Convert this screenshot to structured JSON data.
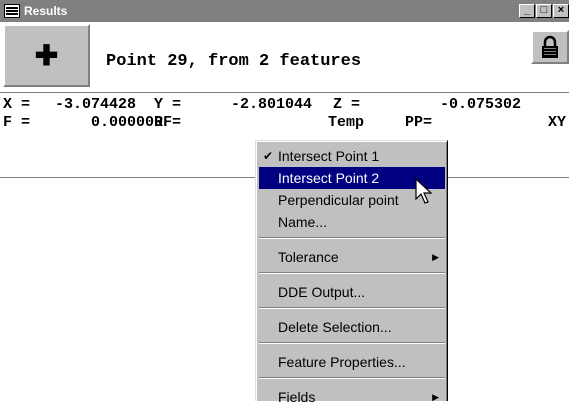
{
  "window": {
    "title": "Results",
    "title_icon": "table-grid-icon",
    "controls": [
      "minimize-icon",
      "maximize-icon",
      "close-icon"
    ]
  },
  "point_button": {
    "icon": "crosshair-plus-icon",
    "glyph": "✚"
  },
  "point_title": "Point 29, from 2 features",
  "lock_button": {
    "icon": "padlock-icon"
  },
  "readout": {
    "row1": {
      "x_label": "X =",
      "x_value": "-3.074428",
      "y_label": "Y =",
      "y_value": "-2.801044",
      "z_label": "Z =",
      "z_value": "-0.075302"
    },
    "row2": {
      "f_label": "F =",
      "f_value": "0.000000",
      "rf_label": "RF=",
      "rf_value": "Temp",
      "pp_label": "PP=",
      "pp_value": "XY"
    }
  },
  "menu": {
    "items": [
      {
        "label": "Intersect Point 1",
        "checked": true
      },
      {
        "label": "Intersect Point 2",
        "selected": true
      },
      {
        "label": "Perpendicular point"
      },
      {
        "label": "Name..."
      },
      {
        "label": "Tolerance",
        "submenu": true
      },
      {
        "label": "DDE Output..."
      },
      {
        "label": "Delete Selection..."
      },
      {
        "label": "Feature Properties..."
      },
      {
        "label": "Fields",
        "submenu": true
      }
    ]
  },
  "colors": {
    "titlebar": "#808080",
    "menu_bg": "#c0c0c0",
    "highlight": "#000080"
  }
}
